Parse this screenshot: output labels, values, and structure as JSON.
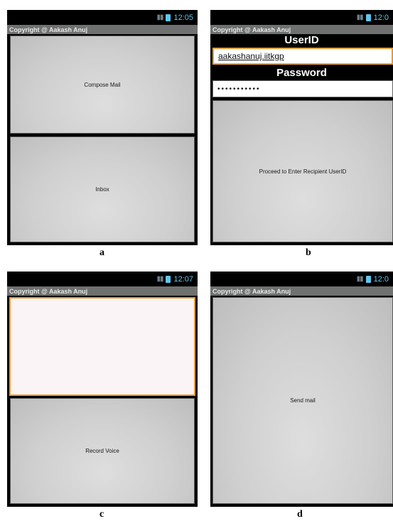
{
  "panels": {
    "a": {
      "caption": "a",
      "time": "12:05",
      "title": "Copyright @ Aakash Anuj",
      "buttons": [
        "Compose Mail",
        "Inbox"
      ]
    },
    "b": {
      "caption": "b",
      "time": "12:0",
      "title": "Copyright @ Aakash Anuj",
      "userid_label": "UserID",
      "userid_value": "aakashanuj.iitkgp",
      "password_label": "Password",
      "password_value": "•••••••••••",
      "proceed_button": "Proceed to Enter Recipient UserID"
    },
    "c": {
      "caption": "c",
      "time": "12:07",
      "title": "Copyright @ Aakash Anuj",
      "record_button": "Record Voice"
    },
    "d": {
      "caption": "d",
      "time": "12:0",
      "title": "Copyright @ Aakash Anuj",
      "send_button": "Send mail"
    }
  },
  "colors": {
    "status_icon": "#5fc6ef",
    "title_bar": "#6f7070",
    "focus_border": "#e49a3a"
  },
  "icons": [
    "signal-icon",
    "battery-icon"
  ]
}
